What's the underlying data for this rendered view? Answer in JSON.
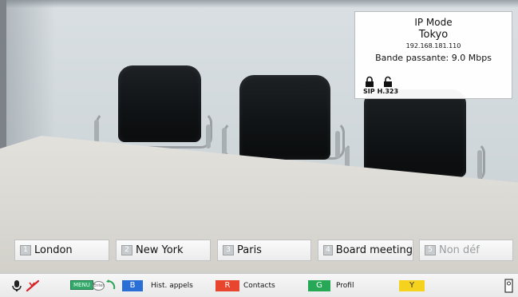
{
  "status_box": {
    "mode": "IP Mode",
    "site": "Tokyo",
    "ip": "192.168.181.110",
    "bandwidth": "Bande passante: 9.0 Mbps",
    "protocols": [
      {
        "label": "SIP",
        "icon": "padlock-closed-icon"
      },
      {
        "label": "H.323",
        "icon": "padlock-open-icon"
      }
    ]
  },
  "speed_dials": [
    {
      "key": "1",
      "label": "London",
      "enabled": true
    },
    {
      "key": "2",
      "label": "New York",
      "enabled": true
    },
    {
      "key": "3",
      "label": "Paris",
      "enabled": true
    },
    {
      "key": "4",
      "label": "Board meeting",
      "enabled": true
    },
    {
      "key": "5",
      "label": "Non déf",
      "enabled": false
    }
  ],
  "keybar": {
    "menu_key": "MENU",
    "enter_key": "Enter",
    "blue_key": "B",
    "blue_label": "Hist. appels",
    "red_key": "R",
    "red_label": "Contacts",
    "green_key": "G",
    "green_label": "Profil",
    "yellow_key": "Y",
    "yellow_label": ""
  },
  "colors": {
    "blue": "#2a6fd6",
    "red": "#e8452f",
    "green": "#27a857",
    "yellow": "#f4d21d",
    "menu_green": "#34a86b"
  },
  "icons": {
    "mic": "microphone-icon",
    "mute": "mute-slash-icon",
    "nav": "direction-arrow-icon",
    "zoom": "zoom-icon"
  }
}
